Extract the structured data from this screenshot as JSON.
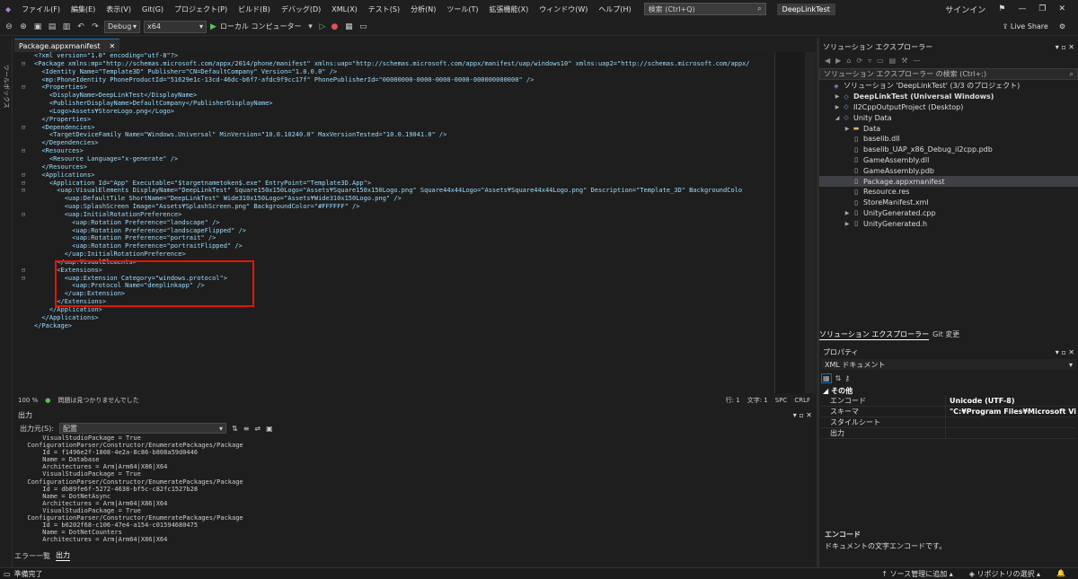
{
  "menu": {
    "items": [
      "ファイル(F)",
      "編集(E)",
      "表示(V)",
      "Git(G)",
      "プロジェクト(P)",
      "ビルド(B)",
      "デバッグ(D)",
      "XML(X)",
      "テスト(S)",
      "分析(N)",
      "ツール(T)",
      "拡張機能(X)",
      "ウィンドウ(W)",
      "ヘルプ(H)"
    ],
    "search_placeholder": "検索 (Ctrl+Q)",
    "project_title": "DeepLinkTest",
    "signin": "サインイン"
  },
  "toolbar": {
    "config": "Debug",
    "platform": "x64",
    "run_target": "ローカル コンピューター",
    "live_share": "Live Share"
  },
  "left_strip_label": "ツールボックス",
  "editor": {
    "tab_label": "Package.appxmanifest",
    "lines": [
      "<?xml version=\"1.0\" encoding=\"utf-8\"?>",
      "<Package xmlns:mp=\"http://schemas.microsoft.com/appx/2014/phone/manifest\" xmlns:uap=\"http://schemas.microsoft.com/appx/manifest/uap/windows10\" xmlns:uap2=\"http://schemas.microsoft.com/appx/",
      "  <Identity Name=\"Template3D\" Publisher=\"CN=DefaultCompany\" Version=\"1.0.0.0\" />",
      "  <mp:PhoneIdentity PhoneProductId=\"51629e1c-13cd-46dc-b6f7-afdc9f9cc17f\" PhonePublisherId=\"00000000-0000-0000-0000-000000000000\" />",
      "  <Properties>",
      "    <DisplayName>DeepLinkTest</DisplayName>",
      "    <PublisherDisplayName>DefaultCompany</PublisherDisplayName>",
      "    <Logo>Assets¥StoreLogo.png</Logo>",
      "  </Properties>",
      "  <Dependencies>",
      "    <TargetDeviceFamily Name=\"Windows.Universal\" MinVersion=\"10.0.10240.0\" MaxVersionTested=\"10.0.19041.0\" />",
      "  </Dependencies>",
      "  <Resources>",
      "    <Resource Language=\"x-generate\" />",
      "  </Resources>",
      "  <Applications>",
      "    <Application Id=\"App\" Executable=\"$targetnametoken$.exe\" EntryPoint=\"Template3D.App\">",
      "      <uap:VisualElements DisplayName=\"DeepLinkTest\" Square150x150Logo=\"Assets¥Square150x150Logo.png\" Square44x44Logo=\"Assets¥Square44x44Logo.png\" Description=\"Template_3D\" BackgroundColo",
      "        <uap:DefaultTile ShortName=\"DeepLinkTest\" Wide310x150Logo=\"Assets¥Wide310x150Logo.png\" />",
      "        <uap:SplashScreen Image=\"Assets¥SplashScreen.png\" BackgroundColor=\"#FFFFFF\" />",
      "        <uap:InitialRotationPreference>",
      "          <uap:Rotation Preference=\"landscape\" />",
      "          <uap:Rotation Preference=\"landscapeFlipped\" />",
      "          <uap:Rotation Preference=\"portrait\" />",
      "          <uap:Rotation Preference=\"portraitFlipped\" />",
      "        </uap:InitialRotationPreference>",
      "      </uap:VisualElements>",
      "      <Extensions>",
      "        <uap:Extension Category=\"windows.protocol\">",
      "          <uap:Protocol Name=\"deeplinkapp\" />",
      "        </uap:Extension>",
      "      </Extensions>",
      "    </Application>",
      "  </Applications>",
      "</Package>"
    ]
  },
  "editor_status": {
    "zoom": "100 %",
    "issues": "問題は見つかりませんでした",
    "line": "行: 1",
    "char": "文字: 1",
    "spc": "SPC",
    "crlf": "CRLF"
  },
  "output": {
    "title": "出力",
    "source_label": "出力元(S):",
    "source_value": "配置",
    "lines": [
      "      VisualStudioPackage = True",
      "  ConfigurationParser/Constructor/EnumeratePackages/Package",
      "      Id = f1496e2f-1808-4e2a-8c86-b808a59d0446",
      "      Name = Database",
      "      Architectures = Arm|Arm64|X86|X64",
      "      VisualStudioPackage = True",
      "  ConfigurationParser/Constructor/EnumeratePackages/Package",
      "      Id = db89fe6f-5272-4638-bf5c-c82fc1527b28",
      "      Name = DotNetAsync",
      "      Architectures = Arm|Arm64|X86|X64",
      "      VisualStudioPackage = True",
      "  ConfigurationParser/Constructor/EnumeratePackages/Package",
      "      Id = b6202f68-c106-47e4-a154-c01594680475",
      "      Name = DotNetCounters",
      "      Architectures = Arm|Arm64|X86|X64"
    ],
    "tab_errors": "エラー一覧",
    "tab_output": "出力"
  },
  "solution_explorer": {
    "title": "ソリューション エクスプローラー",
    "search_placeholder": "ソリューション エクスプローラー の検索 (Ctrl+;)",
    "items": [
      {
        "label": "ソリューション 'DeepLinkTest' (3/3 のプロジェクト)",
        "indent": 0,
        "icon": "solution"
      },
      {
        "label": "DeepLinkTest (Universal Windows)",
        "indent": 1,
        "icon": "project",
        "bold": true
      },
      {
        "label": "Il2CppOutputProject (Desktop)",
        "indent": 1,
        "icon": "project"
      },
      {
        "label": "Unity Data",
        "indent": 1,
        "icon": "project"
      },
      {
        "label": "Data",
        "indent": 2,
        "icon": "folder"
      },
      {
        "label": "baselib.dll",
        "indent": 2,
        "icon": "file"
      },
      {
        "label": "baselib_UAP_x86_Debug_il2cpp.pdb",
        "indent": 2,
        "icon": "file"
      },
      {
        "label": "GameAssembly.dll",
        "indent": 2,
        "icon": "file"
      },
      {
        "label": "GameAssembly.pdb",
        "indent": 2,
        "icon": "file"
      },
      {
        "label": "Package.appxmanifest",
        "indent": 2,
        "icon": "file",
        "selected": true
      },
      {
        "label": "Resource.res",
        "indent": 2,
        "icon": "file"
      },
      {
        "label": "StoreManifest.xml",
        "indent": 2,
        "icon": "file"
      },
      {
        "label": "UnityGenerated.cpp",
        "indent": 2,
        "icon": "file"
      },
      {
        "label": "UnityGenerated.h",
        "indent": 2,
        "icon": "file"
      }
    ],
    "tab_se": "ソリューション エクスプローラー",
    "tab_git": "Git 変更"
  },
  "properties": {
    "title": "プロパティ",
    "object": "XML ドキュメント",
    "category": "その他",
    "rows": [
      {
        "key": "エンコード",
        "value": "Unicode (UTF-8)"
      },
      {
        "key": "スキーマ",
        "value": "\"C:¥Program Files¥Microsoft Visual Studio¥"
      },
      {
        "key": "スタイルシート",
        "value": ""
      },
      {
        "key": "出力",
        "value": ""
      }
    ],
    "desc_title": "エンコード",
    "desc_text": "ドキュメントの文字エンコードです。"
  },
  "statusbar": {
    "ready": "準備完了",
    "source_control": "ソース管理に追加",
    "repo_select": "リポジトリの選択"
  }
}
